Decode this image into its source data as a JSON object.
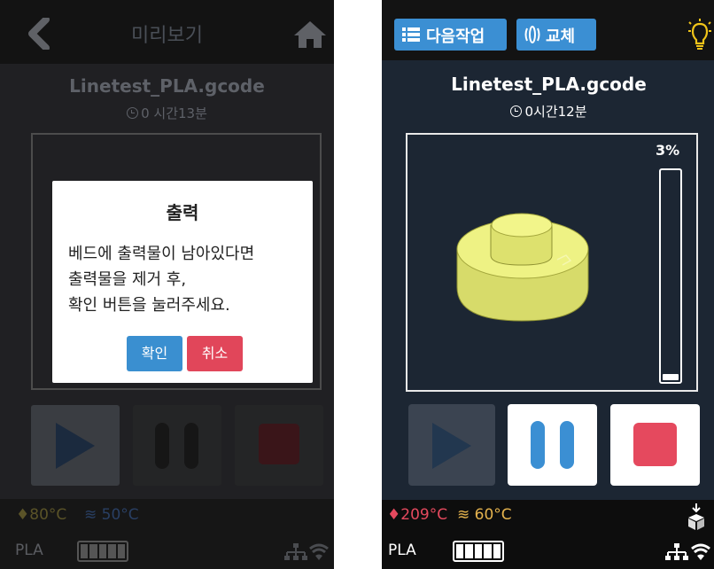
{
  "left_screen": {
    "header": {
      "title": "미리보기"
    },
    "file": {
      "name": "Linetest_PLA.gcode",
      "time": "0 시간13분"
    },
    "dialog": {
      "title": "출력",
      "lines": [
        "베드에 출력물이 남아있다면",
        "출력물을 제거 후,",
        "확인 버튼을 눌러주세요."
      ],
      "confirm_label": "확인",
      "cancel_label": "취소"
    },
    "status": {
      "nozzle_temp": "80°C",
      "bed_temp": "50°C",
      "material": "PLA"
    }
  },
  "right_screen": {
    "header": {
      "next_job_label": "다음작업",
      "swap_label": "교체"
    },
    "file": {
      "name": "Linetest_PLA.gcode",
      "time": "0시간12분"
    },
    "progress": {
      "label": "3%",
      "value": 0.03
    },
    "status": {
      "nozzle_temp": "209°C",
      "bed_temp": "60°C",
      "material": "PLA"
    }
  },
  "colors": {
    "accent_blue": "#3b8fd3",
    "danger_red": "#e1465a",
    "nozzle_red": "#e5495e",
    "bed_orange": "#e5b34e",
    "model_yellow": "#e8ec7a"
  },
  "icons": [
    "back-arrow-icon",
    "home-icon",
    "clock-icon",
    "list-icon",
    "filament-icon",
    "bulb-icon",
    "play-icon",
    "pause-icon",
    "stop-icon",
    "nozzle-icon",
    "bed-icon",
    "cube-icon",
    "network-icon",
    "wifi-icon"
  ]
}
